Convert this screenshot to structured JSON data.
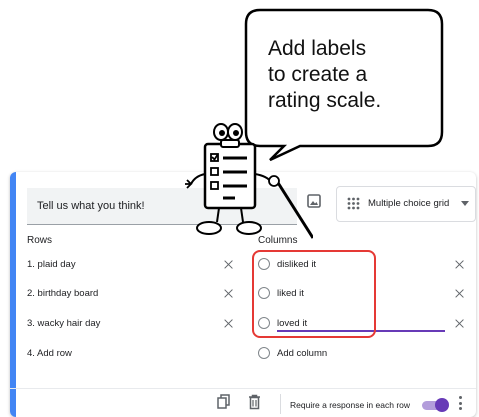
{
  "bubble": {
    "lines": [
      "Add labels",
      "to create a",
      "rating scale."
    ]
  },
  "question": {
    "title": "Tell us what you think!"
  },
  "question_type": {
    "label": "Multiple choice grid",
    "icon": "grid-icon"
  },
  "rows": {
    "heading": "Rows",
    "items": [
      {
        "label": "1. plaid day"
      },
      {
        "label": "2. birthday board"
      },
      {
        "label": "3. wacky hair day"
      }
    ],
    "add_label": "4. Add row"
  },
  "columns": {
    "heading": "Columns",
    "items": [
      {
        "label": "disliked it"
      },
      {
        "label": "liked it"
      },
      {
        "label": "loved it"
      }
    ],
    "add_label": "Add column"
  },
  "footer": {
    "require_label": "Require a response in each row",
    "require_on": true
  },
  "colors": {
    "accent": "#673ab7",
    "highlight": "#e53935",
    "card_accent": "#4285f4"
  }
}
